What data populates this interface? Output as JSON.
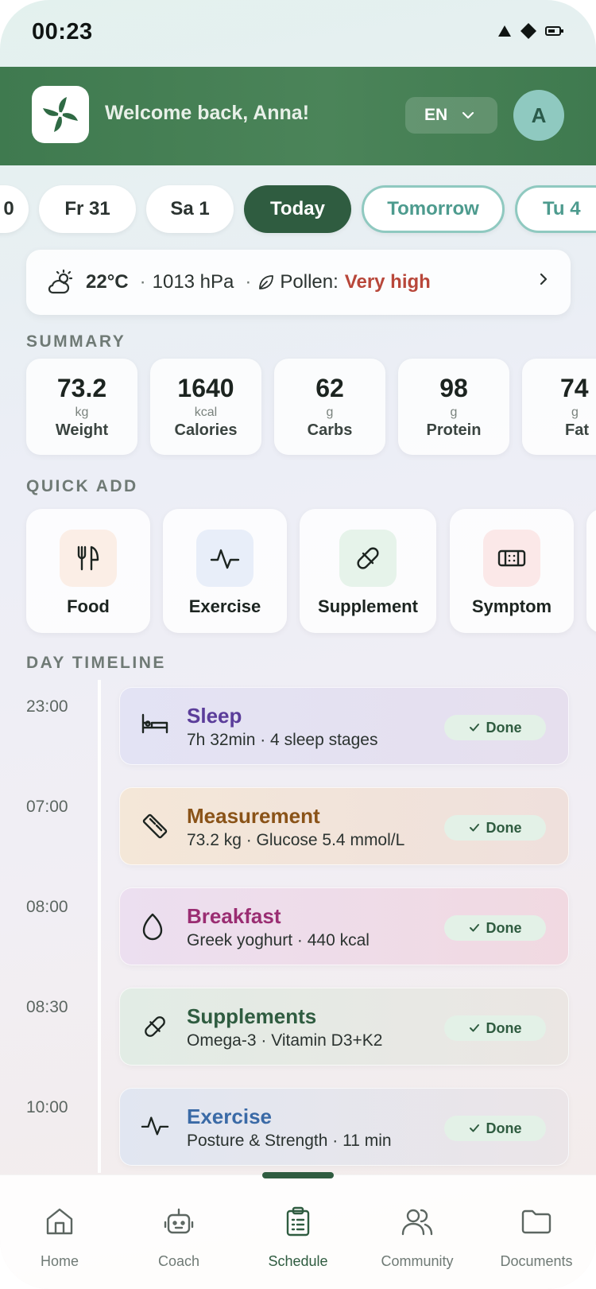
{
  "status_bar": {
    "time": "00:23"
  },
  "header": {
    "welcome": "Welcome back, Anna!",
    "language": "EN",
    "avatar_initial": "A"
  },
  "dates": [
    {
      "label": "0",
      "state": "normal"
    },
    {
      "label": "Fr 31",
      "state": "normal"
    },
    {
      "label": "Sa 1",
      "state": "normal"
    },
    {
      "label": "Today",
      "state": "selected"
    },
    {
      "label": "Tomorrow",
      "state": "outline"
    },
    {
      "label": "Tu 4",
      "state": "outline"
    }
  ],
  "weather": {
    "icon": "partly-cloudy-icon",
    "temperature": "22°C",
    "pressure": "1013 hPa",
    "pollen_label": "Pollen:",
    "pollen_value": "Very high",
    "pollen_color": "#b8473a"
  },
  "summary": {
    "title": "SUMMARY",
    "items": [
      {
        "value": "73.2",
        "unit": "kg",
        "label": "Weight"
      },
      {
        "value": "1640",
        "unit": "kcal",
        "label": "Calories"
      },
      {
        "value": "62",
        "unit": "g",
        "label": "Carbs"
      },
      {
        "value": "98",
        "unit": "g",
        "label": "Protein"
      },
      {
        "value": "74",
        "unit": "g",
        "label": "Fat"
      }
    ]
  },
  "quick_add": {
    "title": "QUICK ADD",
    "items": [
      {
        "label": "Food",
        "icon": "fork-knife-icon",
        "bg": "#fbeee6"
      },
      {
        "label": "Exercise",
        "icon": "pulse-icon",
        "bg": "#e8eef9"
      },
      {
        "label": "Supplement",
        "icon": "pill-icon",
        "bg": "#e6f3ea"
      },
      {
        "label": "Symptom",
        "icon": "bandage-icon",
        "bg": "#fbe8e8"
      }
    ]
  },
  "timeline": {
    "title": "DAY TIMELINE",
    "status_label": "Done",
    "events": [
      {
        "time": "23:00",
        "title": "Sleep",
        "subtitle": "7h 32min · 4 sleep stages",
        "icon": "bed-icon",
        "color": "#5b3d9a",
        "bg": "#e3e2f3"
      },
      {
        "time": "07:00",
        "title": "Measurement",
        "subtitle": "73.2 kg · Glucose 5.4 mmol/L",
        "icon": "ruler-icon",
        "color": "#8a5318",
        "bg": "#f3e6da"
      },
      {
        "time": "08:00",
        "title": "Breakfast",
        "subtitle": "Greek yoghurt · 440 kcal",
        "icon": "drop-icon",
        "color": "#9a2d72",
        "bg": "#f1dde9"
      },
      {
        "time": "08:30",
        "title": "Supplements",
        "subtitle": "Omega-3 · Vitamin D3+K2",
        "icon": "pill-icon",
        "color": "#2f5c40",
        "bg": "#e4ece6"
      },
      {
        "time": "10:00",
        "title": "Exercise",
        "subtitle": "Posture & Strength · 11 min",
        "icon": "pulse-icon",
        "color": "#3a6aa6",
        "bg": "#e3e6ef"
      }
    ]
  },
  "nav": {
    "active_color": "#2f5c40",
    "items": [
      {
        "label": "Home",
        "icon": "home-icon"
      },
      {
        "label": "Coach",
        "icon": "robot-icon"
      },
      {
        "label": "Schedule",
        "icon": "clipboard-icon",
        "active": true
      },
      {
        "label": "Community",
        "icon": "users-icon"
      },
      {
        "label": "Documents",
        "icon": "folder-icon"
      }
    ]
  }
}
